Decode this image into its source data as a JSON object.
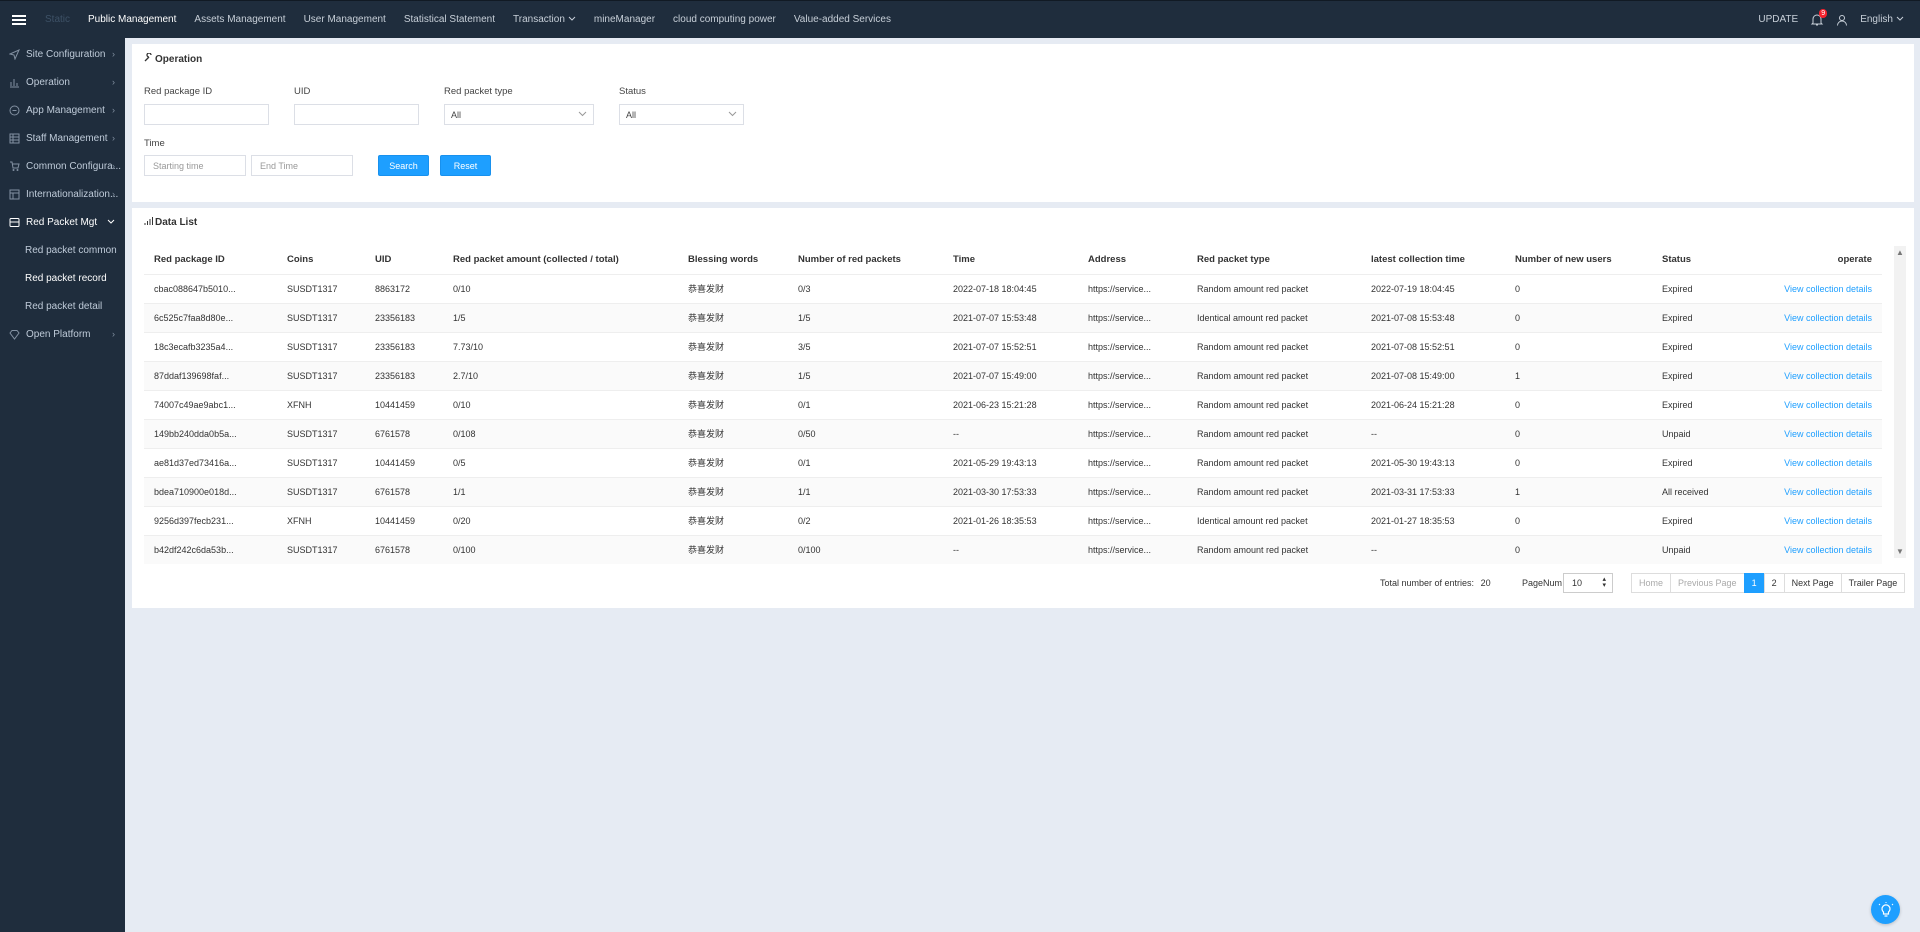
{
  "topbar": {
    "nav": [
      {
        "label": "Static",
        "state": "faded"
      },
      {
        "label": "Public Management",
        "state": "active"
      },
      {
        "label": "Assets Management",
        "state": ""
      },
      {
        "label": "User Management",
        "state": ""
      },
      {
        "label": "Statistical Statement",
        "state": ""
      },
      {
        "label": "Transaction",
        "state": "",
        "dropdown": true
      },
      {
        "label": "mineManager",
        "state": ""
      },
      {
        "label": "cloud computing power",
        "state": ""
      },
      {
        "label": "Value-added Services",
        "state": ""
      }
    ],
    "update_label": "UPDATE",
    "badge_count": "9",
    "language": "English"
  },
  "sidebar": {
    "items": [
      {
        "label": "Site Configuration",
        "icon": "send-icon"
      },
      {
        "label": "Operation",
        "icon": "bar-chart-icon"
      },
      {
        "label": "App Management",
        "icon": "app-icon"
      },
      {
        "label": "Staff Management",
        "icon": "grid-icon"
      },
      {
        "label": "Common Configura...",
        "icon": "cart-icon"
      },
      {
        "label": "Internationalization...",
        "icon": "table-icon"
      },
      {
        "label": "Red Packet Mgt",
        "icon": "gift-icon",
        "open": true
      }
    ],
    "subitems": [
      {
        "label": "Red packet common"
      },
      {
        "label": "Red packet record",
        "active": true
      },
      {
        "label": "Red packet detail"
      }
    ],
    "last_item": {
      "label": "Open Platform",
      "icon": "diamond-icon"
    }
  },
  "operation": {
    "title": "Operation",
    "fields": {
      "red_package_id_label": "Red package ID",
      "uid_label": "UID",
      "type_label": "Red packet type",
      "type_value": "All",
      "status_label": "Status",
      "status_value": "All",
      "time_label": "Time",
      "start_placeholder": "Starting time",
      "end_placeholder": "End Time"
    },
    "search_label": "Search",
    "reset_label": "Reset"
  },
  "datalist": {
    "title": "Data List",
    "columns": [
      "Red package ID",
      "Coins",
      "UID",
      "Red packet amount (collected / total)",
      "Blessing words",
      "Number of red packets",
      "Time",
      "Address",
      "Red packet type",
      "latest collection time",
      "Number of new users",
      "Status",
      "operate"
    ],
    "rows": [
      [
        "cbac088647b5010...",
        "SUSDT1317",
        "8863172",
        "0/10",
        "恭喜发财",
        "0/3",
        "2022-07-18 18:04:45",
        "https://service...",
        "Random amount red packet",
        "2022-07-19 18:04:45",
        "0",
        "Expired",
        "View collection details"
      ],
      [
        "6c525c7faa8d80e...",
        "SUSDT1317",
        "23356183",
        "1/5",
        "恭喜发财",
        "1/5",
        "2021-07-07 15:53:48",
        "https://service...",
        "Identical amount red packet",
        "2021-07-08 15:53:48",
        "0",
        "Expired",
        "View collection details"
      ],
      [
        "18c3ecafb3235a4...",
        "SUSDT1317",
        "23356183",
        "7.73/10",
        "恭喜发财",
        "3/5",
        "2021-07-07 15:52:51",
        "https://service...",
        "Random amount red packet",
        "2021-07-08 15:52:51",
        "0",
        "Expired",
        "View collection details"
      ],
      [
        "87ddaf139698faf...",
        "SUSDT1317",
        "23356183",
        "2.7/10",
        "恭喜发财",
        "1/5",
        "2021-07-07 15:49:00",
        "https://service...",
        "Random amount red packet",
        "2021-07-08 15:49:00",
        "1",
        "Expired",
        "View collection details"
      ],
      [
        "74007c49ae9abc1...",
        "XFNH",
        "10441459",
        "0/10",
        "恭喜发财",
        "0/1",
        "2021-06-23 15:21:28",
        "https://service...",
        "Random amount red packet",
        "2021-06-24 15:21:28",
        "0",
        "Expired",
        "View collection details"
      ],
      [
        "149bb240dda0b5a...",
        "SUSDT1317",
        "6761578",
        "0/108",
        "恭喜发财",
        "0/50",
        "--",
        "https://service...",
        "Random amount red packet",
        "--",
        "0",
        "Unpaid",
        "View collection details"
      ],
      [
        "ae81d37ed73416a...",
        "SUSDT1317",
        "10441459",
        "0/5",
        "恭喜发财",
        "0/1",
        "2021-05-29 19:43:13",
        "https://service...",
        "Random amount red packet",
        "2021-05-30 19:43:13",
        "0",
        "Expired",
        "View collection details"
      ],
      [
        "bdea710900e018d...",
        "SUSDT1317",
        "6761578",
        "1/1",
        "恭喜发财",
        "1/1",
        "2021-03-30 17:53:33",
        "https://service...",
        "Random amount red packet",
        "2021-03-31 17:53:33",
        "1",
        "All received",
        "View collection details"
      ],
      [
        "9256d397fecb231...",
        "XFNH",
        "10441459",
        "0/20",
        "恭喜发财",
        "0/2",
        "2021-01-26 18:35:53",
        "https://service...",
        "Identical amount red packet",
        "2021-01-27 18:35:53",
        "0",
        "Expired",
        "View collection details"
      ],
      [
        "b42df242c6da53b...",
        "SUSDT1317",
        "6761578",
        "0/100",
        "恭喜发财",
        "0/100",
        "--",
        "https://service...",
        "Random amount red packet",
        "--",
        "0",
        "Unpaid",
        "View collection details"
      ]
    ]
  },
  "pagination": {
    "total_label": "Total number of entries:",
    "total_value": "20",
    "pagenum_label": "PageNum",
    "pagesize": "10",
    "home": "Home",
    "prev": "Previous Page",
    "pages": [
      "1",
      "2"
    ],
    "current": "1",
    "next": "Next Page",
    "last": "Trailer Page"
  },
  "colors": {
    "accent": "#1e9fff",
    "sidebar": "#1f2d3d",
    "background": "#e6ebf3"
  }
}
